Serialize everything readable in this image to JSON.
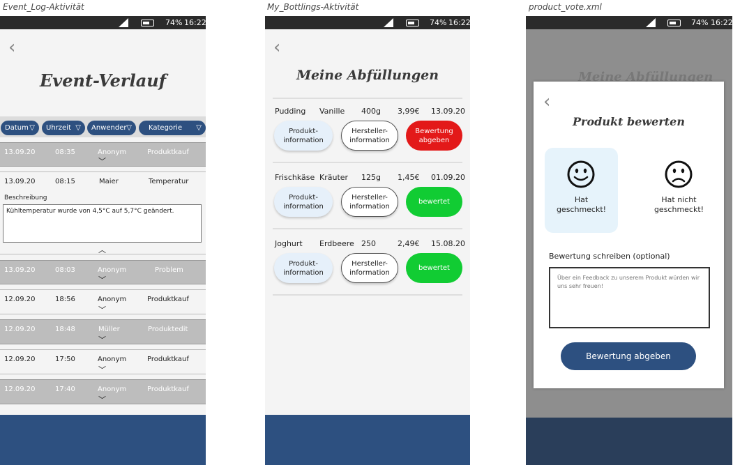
{
  "captions": {
    "event_log": "Event_Log-Aktivität",
    "bottlings": "My_Bottlings-Aktivität",
    "vote": "product_vote.xml"
  },
  "status": {
    "battery": "74%",
    "time": "16:22"
  },
  "icons": {
    "back": "chevron-left-icon",
    "expand": "chevron-down-icon",
    "collapse": "chevron-up-icon",
    "signal": "signal-icon",
    "battery": "battery-icon"
  },
  "colors": {
    "primary": "#2d5080",
    "red": "#e31919",
    "green": "#11cc33",
    "light_blue": "#e6f0fa"
  },
  "event_log": {
    "title": "Event-Verlauf",
    "filters": [
      "Datum",
      "Uhrzeit",
      "Anwender",
      "Kategorie"
    ],
    "rows": [
      {
        "date": "13.09.20",
        "time": "08:35",
        "user": "Anonym",
        "category": "Produktkauf"
      },
      {
        "date": "13.09.20",
        "time": "08:15",
        "user": "Maier",
        "category": "Temperatur"
      },
      {
        "date": "13.09.20",
        "time": "08:03",
        "user": "Anonym",
        "category": "Problem"
      },
      {
        "date": "12.09.20",
        "time": "18:56",
        "user": "Anonym",
        "category": "Produktkauf"
      },
      {
        "date": "12.09.20",
        "time": "18:48",
        "user": "Müller",
        "category": "Produktedit"
      },
      {
        "date": "12.09.20",
        "time": "17:50",
        "user": "Anonym",
        "category": "Produktkauf"
      },
      {
        "date": "12.09.20",
        "time": "17:40",
        "user": "Anonym",
        "category": "Produktkauf"
      }
    ],
    "description_label": "Beschreibung",
    "description_text": "Kühltemperatur wurde von 4,5°C auf 5,7°C geändert."
  },
  "bottlings": {
    "title": "Meine Abfüllungen",
    "buttons": {
      "product_info": "Produkt-\ninformation",
      "manufacturer_info": "Hersteller-\ninformation",
      "rate": "Bewertung\nabgeben",
      "rated": "bewertet"
    },
    "items": [
      {
        "product": "Pudding",
        "flavor": "Vanille",
        "amount": "400g",
        "price": "3,99€",
        "date": "13.09.20",
        "status": "rate"
      },
      {
        "product": "Frischkäse",
        "flavor": "Kräuter",
        "amount": "125g",
        "price": "1,45€",
        "date": "01.09.20",
        "status": "rated"
      },
      {
        "product": "Joghurt",
        "flavor": "Erdbeere",
        "amount": "250",
        "price": "2,49€",
        "date": "15.08.20",
        "status": "rated"
      }
    ]
  },
  "vote": {
    "background_title": "Meine Abfüllungen",
    "title": "Produkt bewerten",
    "liked": "Hat\ngeschmeckt!",
    "disliked": "Hat nicht\ngeschmeckt!",
    "review_label": "Bewertung schreiben (optional)",
    "review_placeholder": "Über ein Feedback zu unserem Produkt würden wir uns sehr freuen!",
    "submit": "Bewertung abgeben"
  }
}
